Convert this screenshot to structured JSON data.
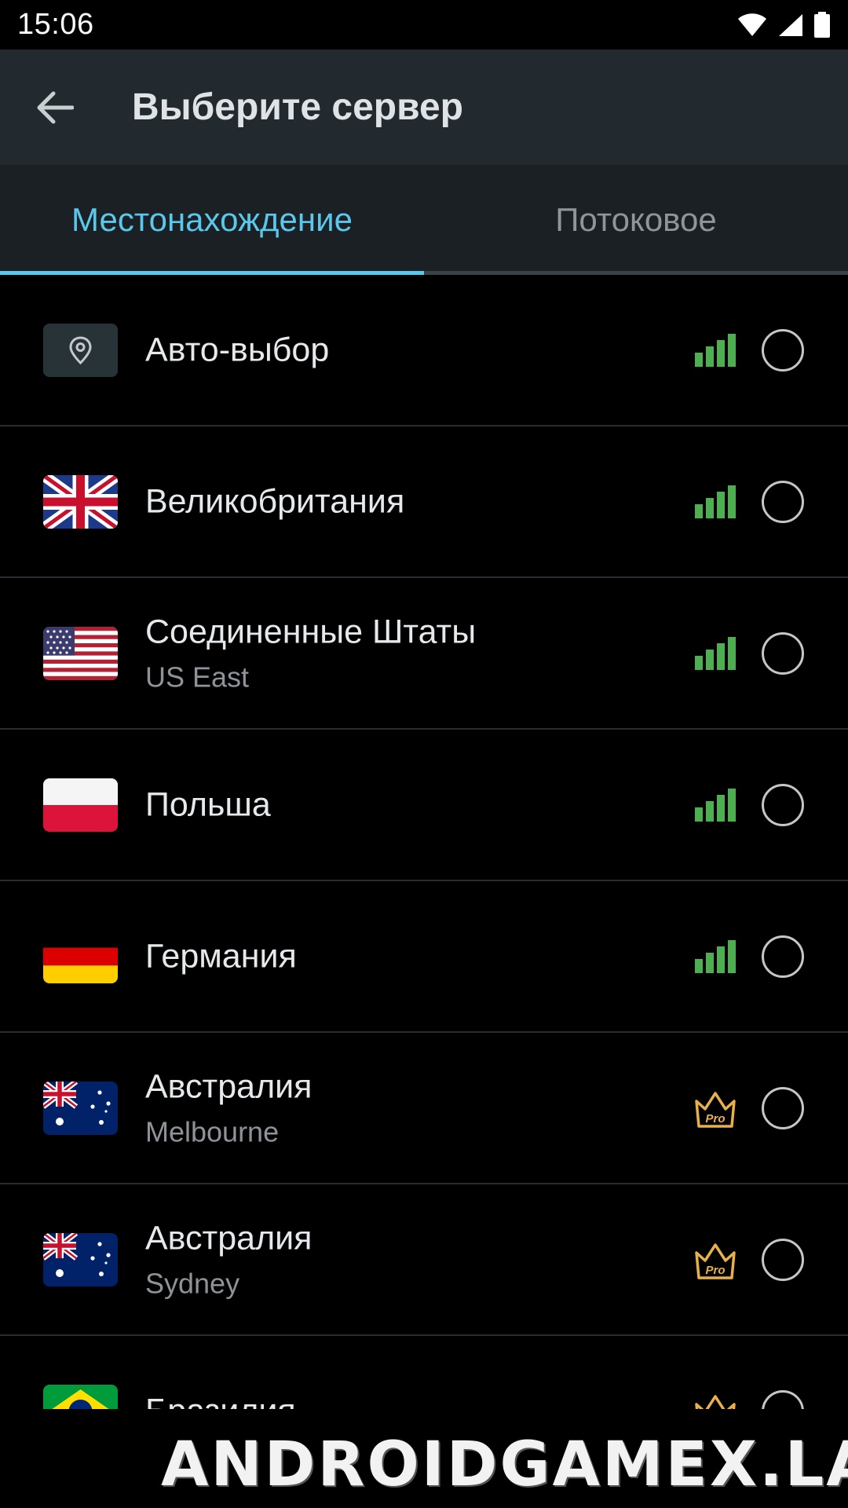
{
  "status_bar": {
    "time": "15:06"
  },
  "app_bar": {
    "title": "Выберите сервер"
  },
  "tabs": [
    {
      "label": "Местонахождение",
      "active": true
    },
    {
      "label": "Потоковое",
      "active": false
    }
  ],
  "servers": [
    {
      "country": "Авто-выбор",
      "city": "",
      "icon": "location-pin-icon",
      "tier": "signal"
    },
    {
      "country": "Великобритания",
      "city": "",
      "icon": "uk-flag-icon",
      "tier": "signal"
    },
    {
      "country": "Соединенные Штаты",
      "city": "US East",
      "icon": "us-flag-icon",
      "tier": "signal"
    },
    {
      "country": "Польша",
      "city": "",
      "icon": "poland-flag-icon",
      "tier": "signal"
    },
    {
      "country": "Германия",
      "city": "",
      "icon": "germany-flag-icon",
      "tier": "signal"
    },
    {
      "country": "Австралия",
      "city": "Melbourne",
      "icon": "australia-flag-icon",
      "tier": "pro"
    },
    {
      "country": "Австралия",
      "city": "Sydney",
      "icon": "australia-flag-icon",
      "tier": "pro"
    },
    {
      "country": "Бразилия",
      "city": "",
      "icon": "brazil-flag-icon",
      "tier": "pro"
    }
  ],
  "pro_badge_label": "Pro",
  "watermark": "ANDROIDGAMEX.LAT",
  "colors": {
    "accent": "#5bc7ea",
    "signal_green": "#4caf50",
    "pro_gold": "#e8b04a",
    "app_bar": "#222a2f",
    "tab_bar": "#1a2024"
  }
}
